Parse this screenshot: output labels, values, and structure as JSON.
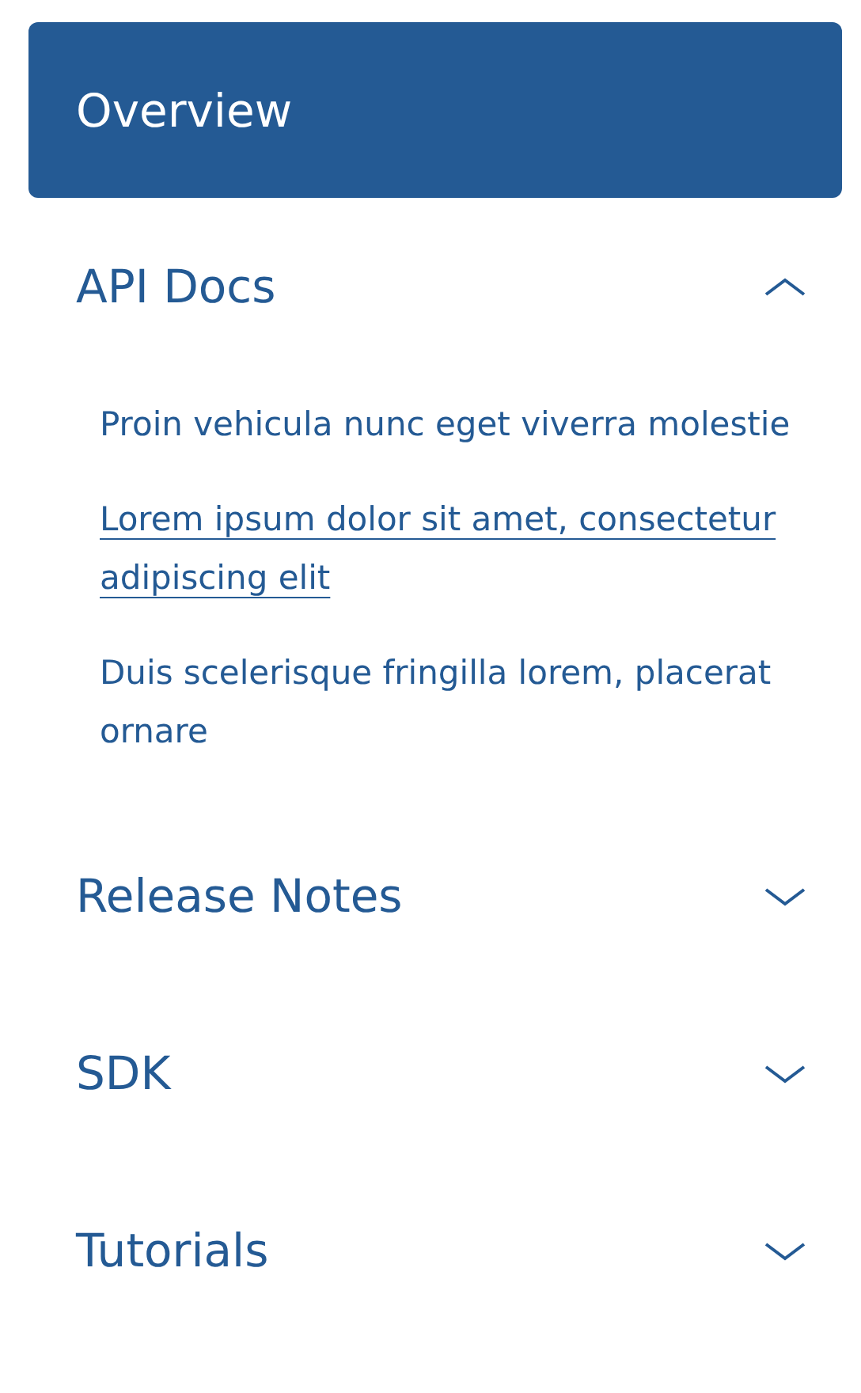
{
  "overview": {
    "label": "Overview",
    "selected": true
  },
  "sections": [
    {
      "title": "API Docs",
      "expanded": true,
      "items": [
        {
          "label": "Proin vehicula nunc eget viverra molestie",
          "hovered": false
        },
        {
          "label": "Lorem ipsum dolor sit amet, consectetur adipiscing elit",
          "hovered": true
        },
        {
          "label": "Duis scelerisque fringilla lorem, placerat ornare",
          "hovered": false
        }
      ]
    },
    {
      "title": "Release Notes",
      "expanded": false
    },
    {
      "title": "SDK",
      "expanded": false
    },
    {
      "title": "Tutorials",
      "expanded": false
    }
  ]
}
